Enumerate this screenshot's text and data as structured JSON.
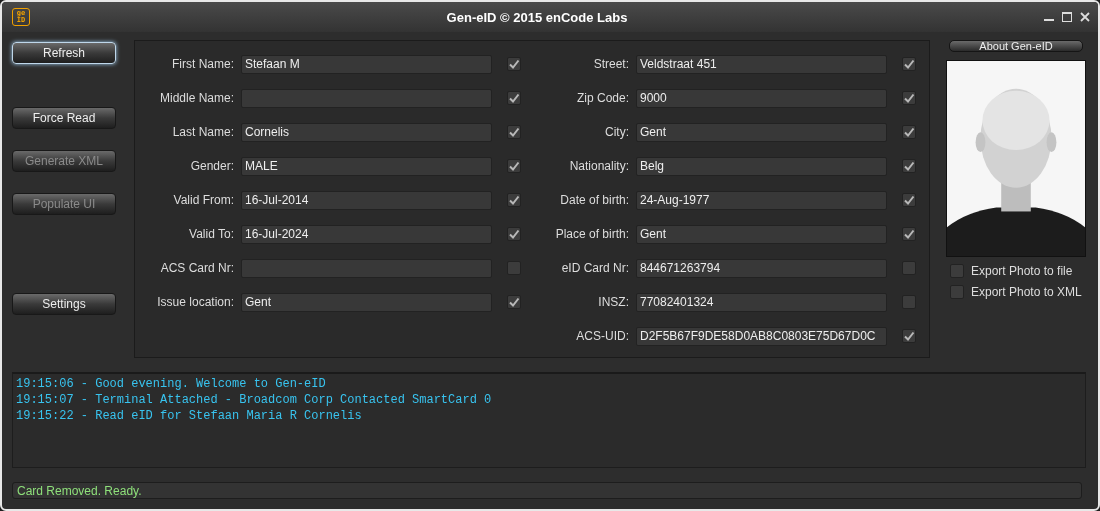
{
  "window": {
    "title": "Gen-eID © 2015 enCode Labs",
    "logo": [
      "ge",
      "ID"
    ]
  },
  "buttons": [
    {
      "label": "Refresh",
      "focused": true,
      "disabled": false
    },
    {
      "label": "Force Read",
      "focused": false,
      "disabled": false
    },
    {
      "label": "Generate XML",
      "focused": false,
      "disabled": true
    },
    {
      "label": "Populate UI",
      "focused": false,
      "disabled": true
    },
    {
      "label": "Settings",
      "focused": false,
      "disabled": false
    }
  ],
  "left_fields": [
    {
      "label": "First Name:",
      "value": "Stefaan M",
      "checked": true
    },
    {
      "label": "Middle Name:",
      "checked": true
    },
    {
      "label": "Last Name:",
      "value": "Cornelis",
      "checked": true
    },
    {
      "label": "Gender:",
      "value": "MALE",
      "checked": true
    },
    {
      "label": "Valid From:",
      "value": "16-Jul-2014",
      "checked": true
    },
    {
      "label": "Valid To:",
      "value": "16-Jul-2024",
      "checked": true
    },
    {
      "label": "ACS Card Nr:",
      "checked": false
    },
    {
      "label": "Issue location:",
      "value": "Gent",
      "checked": true
    }
  ],
  "right_fields": [
    {
      "label": "Street:",
      "value": "Veldstraat 451",
      "checked": true
    },
    {
      "label": "Zip Code:",
      "value": "9000",
      "checked": true
    },
    {
      "label": "City:",
      "value": "Gent",
      "checked": true
    },
    {
      "label": "Nationality:",
      "value": "Belg",
      "checked": true
    },
    {
      "label": "Date of birth:",
      "value": "24-Aug-1977",
      "checked": true
    },
    {
      "label": "Place of birth:",
      "value": "Gent",
      "checked": true
    },
    {
      "label": "eID Card Nr:",
      "value": "844671263794",
      "checked": false
    },
    {
      "label": "INSZ:",
      "value": "77082401324",
      "checked": false
    },
    {
      "label": "ACS-UID:",
      "value": "D2F5B67F9DE58D0AB8C0803E75D67D0C",
      "checked": true
    }
  ],
  "about_button": "About Gen-eID",
  "export_options": [
    {
      "label": "Export Photo to file",
      "checked": false
    },
    {
      "label": "Export Photo to XML",
      "checked": false
    }
  ],
  "log": [
    "19:15:06 - Good evening. Welcome to Gen-eID",
    "19:15:07 - Terminal Attached - Broadcom Corp Contacted SmartCard 0",
    "19:15:22 - Read eID for Stefaan Maria R Cornelis"
  ],
  "status_bar": "Card Removed. Ready."
}
